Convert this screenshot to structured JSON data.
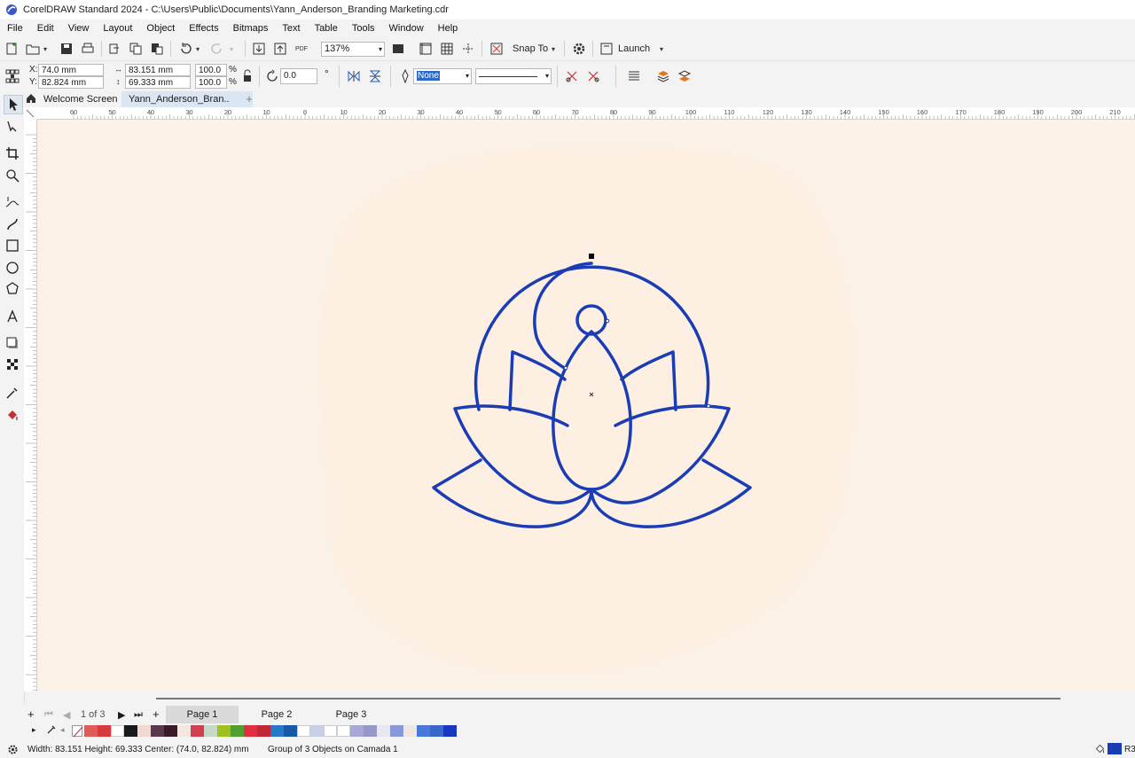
{
  "window": {
    "title": "CorelDRAW Standard 2024 - C:\\Users\\Public\\Documents\\Yann_Anderson_Branding Marketing.cdr"
  },
  "menu": [
    "File",
    "Edit",
    "View",
    "Layout",
    "Object",
    "Effects",
    "Bitmaps",
    "Text",
    "Table",
    "Tools",
    "Window",
    "Help"
  ],
  "toolbar": {
    "zoom": "137%",
    "snap_to": "Snap To",
    "launch": "Launch"
  },
  "property_bar": {
    "x_label": "X:",
    "y_label": "Y:",
    "x_value": "74.0 mm",
    "y_value": "82.824 mm",
    "width_value": "83.151 mm",
    "height_value": "69.333 mm",
    "scale_w": "100.0",
    "scale_h": "100.0",
    "percent": "%",
    "rotation": "0.0",
    "degree": "°",
    "outline_width": "None"
  },
  "doc_tabs": {
    "welcome": "Welcome Screen",
    "active": "Yann_Anderson_Bran.."
  },
  "ruler": {
    "h_labels": [
      "60",
      "50",
      "40",
      "30",
      "20",
      "10",
      "0",
      "10",
      "20",
      "30",
      "40",
      "50",
      "60",
      "70",
      "80",
      "90",
      "100",
      "110",
      "120",
      "130",
      "140",
      "150",
      "160",
      "170",
      "180",
      "190",
      "200",
      "210"
    ]
  },
  "pages": {
    "counter": "1 of 3",
    "tabs": [
      "Page 1",
      "Page 2",
      "Page 3"
    ]
  },
  "palette": [
    "#e05a5a",
    "#d83b3b",
    "#ffffff",
    "#1a1a1a",
    "#f2d8d0",
    "#5a3a4a",
    "#3a1a2a",
    "#f2e8e0",
    "#d04050",
    "#c8d8c8",
    "#a0c020",
    "#50a030",
    "#e03040",
    "#c02838",
    "#2878c8",
    "#1858a8",
    "#ffffff",
    "#c8d0e8",
    "#ffffff",
    "#ffffff",
    "#a8a8d8",
    "#9898c8",
    "#e8e8f0",
    "#8898d8",
    "#f0e8e0",
    "#4878d8",
    "#3868c8",
    "#1838c0"
  ],
  "status": {
    "dimensions": "Width: 83.151  Height: 69.333  Center: (74.0, 82.824)  mm",
    "selection": "Group of 3 Objects on Camada 1",
    "extra": "R3"
  },
  "colors": {
    "logo_stroke": "#1a3db5",
    "canvas": "#fcf1e6"
  }
}
